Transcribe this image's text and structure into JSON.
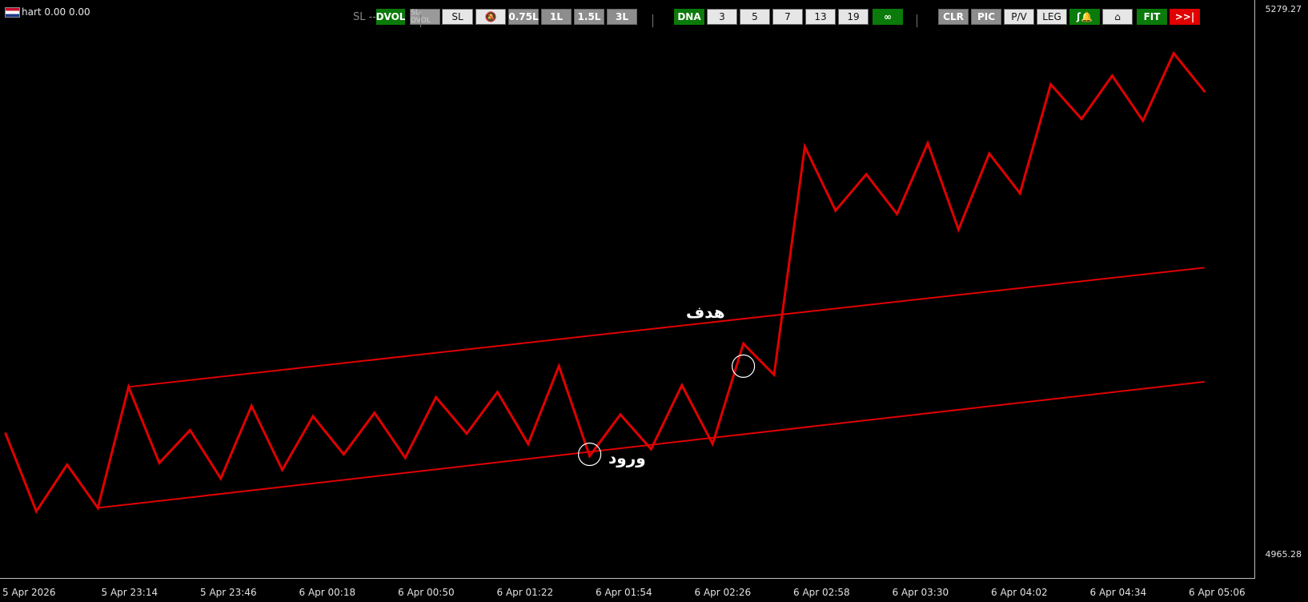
{
  "symbol": {
    "label": "hart 0.00 0.00",
    "flag_icon": "flag-icon"
  },
  "toolbar": {
    "sl_text": "SL --",
    "buttons": [
      {
        "label": "DVOL",
        "style": "green"
      },
      {
        "label": "SL-DVOL",
        "style": "disabled"
      },
      {
        "label": "SL",
        "style": "light"
      },
      {
        "label": "",
        "style": "light",
        "icon": "bell-off-icon"
      },
      {
        "label": "0.75L",
        "style": "gray"
      },
      {
        "label": "1L",
        "style": "gray"
      },
      {
        "label": "1.5L",
        "style": "gray"
      },
      {
        "label": "3L",
        "style": "gray"
      },
      {
        "label": "DNA",
        "style": "green"
      },
      {
        "label": "3",
        "style": "light"
      },
      {
        "label": "5",
        "style": "light"
      },
      {
        "label": "7",
        "style": "light"
      },
      {
        "label": "13",
        "style": "light"
      },
      {
        "label": "19",
        "style": "light"
      },
      {
        "label": "∞",
        "style": "green"
      },
      {
        "label": "CLR",
        "style": "gray"
      },
      {
        "label": "PIC",
        "style": "gray"
      },
      {
        "label": "P/V",
        "style": "light"
      },
      {
        "label": "LEG",
        "style": "light"
      },
      {
        "label": "",
        "style": "green",
        "icon": "alert-bell-icon"
      },
      {
        "label": "",
        "style": "light",
        "icon": "arch-icon"
      },
      {
        "label": "FIT",
        "style": "green"
      },
      {
        "label": ">>|",
        "style": "red"
      }
    ]
  },
  "price_axis": {
    "top": "5279.27",
    "bottom": "4965.28"
  },
  "time_axis": [
    "5 Apr 2026",
    "5 Apr 23:14",
    "5 Apr 23:46",
    "6 Apr 00:18",
    "6 Apr 00:50",
    "6 Apr 01:22",
    "6 Apr 01:54",
    "6 Apr 02:26",
    "6 Apr 02:58",
    "6 Apr 03:30",
    "6 Apr 04:02",
    "6 Apr 04:34",
    "6 Apr 05:06"
  ],
  "annotations": {
    "target": "هدف",
    "entry": "ورود"
  },
  "chart_data": {
    "type": "line",
    "title": "",
    "ylim": [
      4965.28,
      5279.27
    ],
    "line_color": "#e00000",
    "background": "#000000",
    "grid": false,
    "series": [
      {
        "values": [
          5034,
          4989,
          5016,
          4991,
          5061,
          5017,
          5036,
          5008,
          5050,
          5013,
          5044,
          5022,
          5046,
          5020,
          5055,
          5034,
          5058,
          5028,
          5073,
          5021,
          5045,
          5025,
          5062,
          5028,
          5086,
          5068,
          5200,
          5163,
          5184,
          5161,
          5202,
          5152,
          5196,
          5173,
          5236,
          5216,
          5241,
          5215,
          5254,
          5232
        ]
      }
    ],
    "channel_upper": {
      "start_index": 4,
      "start_value": 5061,
      "end_index": 39,
      "end_value": 5130
    },
    "channel_lower": {
      "start_index": 3,
      "start_value": 4991,
      "end_index": 39,
      "end_value": 5064
    },
    "entry_point": {
      "index": 19,
      "value": 5022
    },
    "target_point": {
      "index": 24,
      "value": 5073
    }
  }
}
